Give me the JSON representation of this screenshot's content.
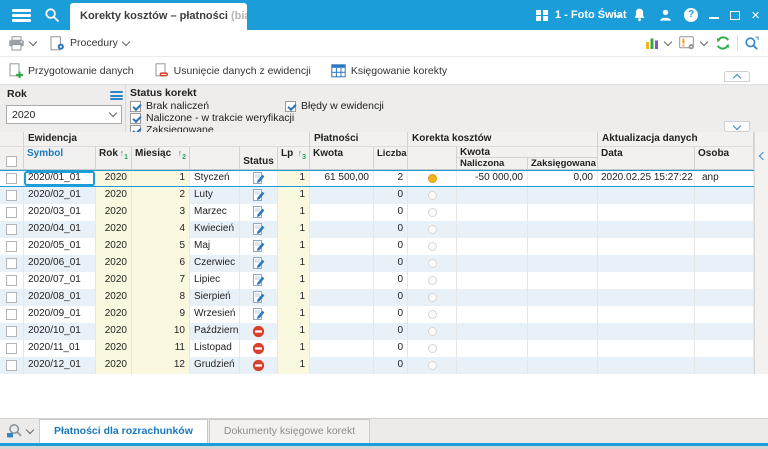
{
  "titlebar": {
    "tab_title": "Korekty kosztów – płatności",
    "tab_suffix": "(biala",
    "company": "1 - Foto Świat"
  },
  "toolbar": {
    "procedury": "Procedury"
  },
  "actions": {
    "prepare": "Przygotowanie danych",
    "remove": "Usunięcie danych z ewidencji",
    "book": "Księgowanie korekty"
  },
  "filters": {
    "rok_label": "Rok",
    "rok_value": "2020",
    "status_label": "Status korekt",
    "checkboxes": [
      {
        "label": "Brak naliczeń",
        "checked": true
      },
      {
        "label": "Naliczone - w trakcie weryfikacji",
        "checked": true
      },
      {
        "label": "Zaksięgowane",
        "checked": true
      },
      {
        "label": "Błędy w ewidencji",
        "checked": true
      }
    ]
  },
  "table": {
    "groups": {
      "ewidencja": "Ewidencja",
      "platnosci": "Płatności",
      "korekta": "Korekta kosztów",
      "aktualizacja": "Aktualizacja danych"
    },
    "cols": {
      "symbol": "Symbol",
      "rok": "Rok",
      "miesiac": "Miesiąc",
      "status": "Status",
      "lp": "Lp",
      "kwota": "Kwota",
      "liczba": "Liczba",
      "kwota_korekty": "Kwota",
      "naliczona": "Naliczona",
      "zaksiegowana": "Zaksięgowana",
      "data": "Data",
      "osoba": "Osoba"
    },
    "sort": {
      "rok": "1",
      "miesiac": "2",
      "lp": "3"
    },
    "rows": [
      {
        "symbol": "2020/01_01",
        "rok": "2020",
        "miesiac": "1",
        "nazwa": "Styczeń",
        "status": "edit",
        "lp": "1",
        "kwota": "61 500,00",
        "liczba": "2",
        "dot": "filled",
        "naliczona": "-50 000,00",
        "zaksiegowana": "0,00",
        "data": "2020.02.25 15:27:22",
        "osoba": "anp",
        "selected": true
      },
      {
        "symbol": "2020/02_01",
        "rok": "2020",
        "miesiac": "2",
        "nazwa": "Luty",
        "status": "edit",
        "lp": "1",
        "kwota": "",
        "liczba": "0",
        "dot": "empty",
        "naliczona": "",
        "zaksiegowana": "",
        "data": "",
        "osoba": "",
        "selected": false
      },
      {
        "symbol": "2020/03_01",
        "rok": "2020",
        "miesiac": "3",
        "nazwa": "Marzec",
        "status": "edit",
        "lp": "1",
        "kwota": "",
        "liczba": "0",
        "dot": "empty",
        "naliczona": "",
        "zaksiegowana": "",
        "data": "",
        "osoba": "",
        "selected": false
      },
      {
        "symbol": "2020/04_01",
        "rok": "2020",
        "miesiac": "4",
        "nazwa": "Kwiecień",
        "status": "edit",
        "lp": "1",
        "kwota": "",
        "liczba": "0",
        "dot": "empty",
        "naliczona": "",
        "zaksiegowana": "",
        "data": "",
        "osoba": "",
        "selected": false
      },
      {
        "symbol": "2020/05_01",
        "rok": "2020",
        "miesiac": "5",
        "nazwa": "Maj",
        "status": "edit",
        "lp": "1",
        "kwota": "",
        "liczba": "0",
        "dot": "empty",
        "naliczona": "",
        "zaksiegowana": "",
        "data": "",
        "osoba": "",
        "selected": false
      },
      {
        "symbol": "2020/06_01",
        "rok": "2020",
        "miesiac": "6",
        "nazwa": "Czerwiec",
        "status": "edit",
        "lp": "1",
        "kwota": "",
        "liczba": "0",
        "dot": "empty",
        "naliczona": "",
        "zaksiegowana": "",
        "data": "",
        "osoba": "",
        "selected": false
      },
      {
        "symbol": "2020/07_01",
        "rok": "2020",
        "miesiac": "7",
        "nazwa": "Lipiec",
        "status": "edit",
        "lp": "1",
        "kwota": "",
        "liczba": "0",
        "dot": "empty",
        "naliczona": "",
        "zaksiegowana": "",
        "data": "",
        "osoba": "",
        "selected": false
      },
      {
        "symbol": "2020/08_01",
        "rok": "2020",
        "miesiac": "8",
        "nazwa": "Sierpień",
        "status": "edit",
        "lp": "1",
        "kwota": "",
        "liczba": "0",
        "dot": "empty",
        "naliczona": "",
        "zaksiegowana": "",
        "data": "",
        "osoba": "",
        "selected": false
      },
      {
        "symbol": "2020/09_01",
        "rok": "2020",
        "miesiac": "9",
        "nazwa": "Wrzesień",
        "status": "edit",
        "lp": "1",
        "kwota": "",
        "liczba": "0",
        "dot": "empty",
        "naliczona": "",
        "zaksiegowana": "",
        "data": "",
        "osoba": "",
        "selected": false
      },
      {
        "symbol": "2020/10_01",
        "rok": "2020",
        "miesiac": "10",
        "nazwa": "Październik",
        "status": "blocked",
        "lp": "1",
        "kwota": "",
        "liczba": "0",
        "dot": "empty",
        "naliczona": "",
        "zaksiegowana": "",
        "data": "",
        "osoba": "",
        "selected": false
      },
      {
        "symbol": "2020/11_01",
        "rok": "2020",
        "miesiac": "11",
        "nazwa": "Listopad",
        "status": "blocked",
        "lp": "1",
        "kwota": "",
        "liczba": "0",
        "dot": "empty",
        "naliczona": "",
        "zaksiegowana": "",
        "data": "",
        "osoba": "",
        "selected": false
      },
      {
        "symbol": "2020/12_01",
        "rok": "2020",
        "miesiac": "12",
        "nazwa": "Grudzień",
        "status": "blocked",
        "lp": "1",
        "kwota": "",
        "liczba": "0",
        "dot": "empty",
        "naliczona": "",
        "zaksiegowana": "",
        "data": "",
        "osoba": "",
        "selected": false
      }
    ]
  },
  "footer": {
    "tabs": [
      {
        "label": "Płatności dla rozrachunków",
        "active": true
      },
      {
        "label": "Dokumenty księgowe korekt",
        "active": false
      }
    ]
  },
  "colors": {
    "accent": "#1b9dd9",
    "row_alt": "#e9f1f8",
    "cell_yellow": "#fbf8e0",
    "dot_filled": "#f2b01e",
    "status_blocked": "#d6402c",
    "link_blue": "#1779be"
  }
}
